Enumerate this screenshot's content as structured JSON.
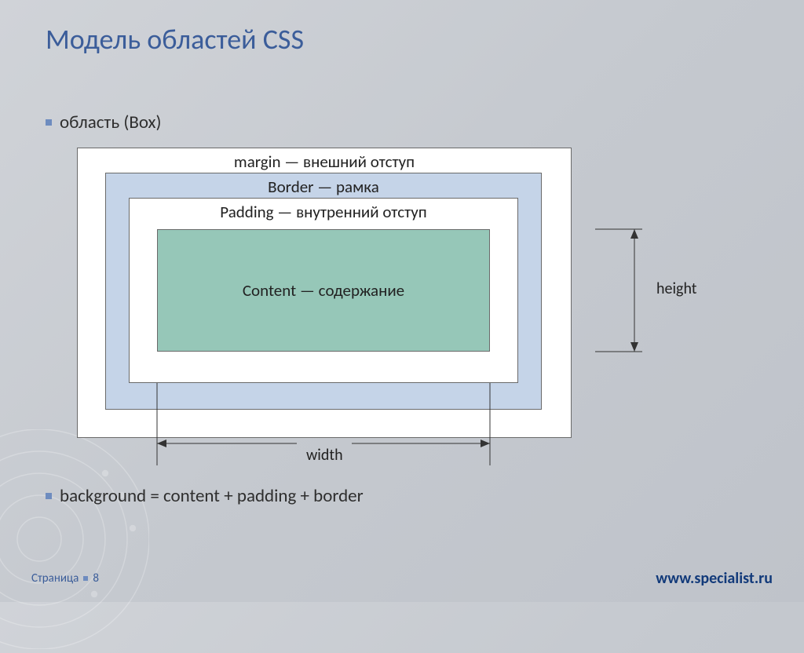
{
  "title": "Модель областей CSS",
  "bullets": {
    "first": "область (Box)",
    "second": "background = content + padding + border"
  },
  "boxes": {
    "margin": "margin — внешний отступ",
    "border": "Border — рамка",
    "padding": "Padding — внутренний отступ",
    "content": "Content — содержание"
  },
  "dims": {
    "height": "height",
    "width": "width"
  },
  "footer": {
    "page_word": "Страница",
    "page_num": "8",
    "site": "www.specialist.ru"
  }
}
